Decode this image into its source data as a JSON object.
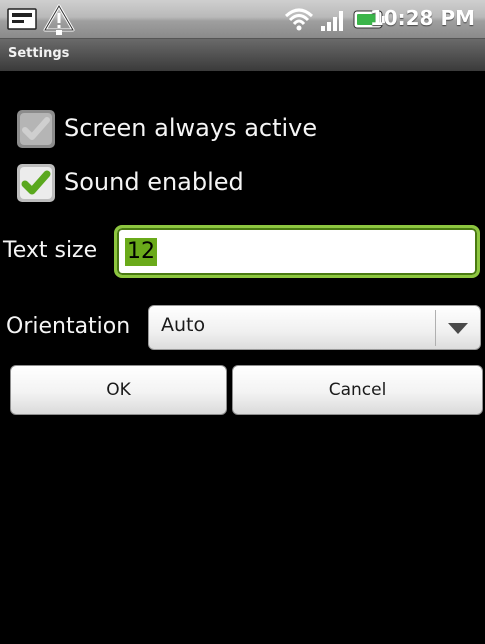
{
  "status_bar": {
    "time": "10:28 PM",
    "icons": [
      "message-icon",
      "warning-icon",
      "wifi-icon",
      "signal-icon",
      "battery-icon"
    ]
  },
  "title_bar": {
    "title": "Settings"
  },
  "settings": {
    "screen_always_active": {
      "label": "Screen always active",
      "checked": false,
      "enabled": false
    },
    "sound_enabled": {
      "label": "Sound enabled",
      "checked": true,
      "enabled": true
    },
    "text_size": {
      "label": "Text size",
      "value": "12"
    },
    "orientation": {
      "label": "Orientation",
      "selected": "Auto"
    }
  },
  "buttons": {
    "ok_label": "OK",
    "cancel_label": "Cancel"
  },
  "colors": {
    "accent_green": "#8dc63f",
    "check_green": "#6aaa1a",
    "background": "#000000"
  }
}
